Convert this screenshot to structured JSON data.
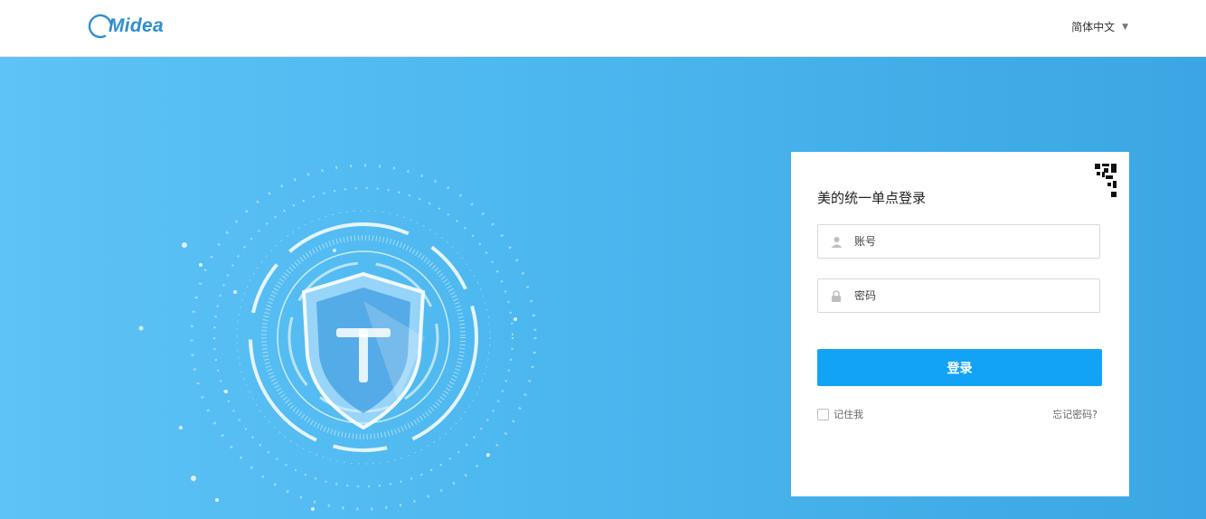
{
  "header": {
    "logo_text": "Midea",
    "language": "简体中文"
  },
  "login": {
    "title": "美的统一单点登录",
    "username_placeholder": "账号",
    "password_placeholder": "密码",
    "submit_label": "登录",
    "remember_label": "记住我",
    "forgot_label": "忘记密码?"
  },
  "icons": {
    "logo": "midea-logo",
    "caret": "chevron-down-icon",
    "qr": "qr-code-icon",
    "user": "user-icon",
    "lock": "lock-icon",
    "hero": "shield-illustration"
  },
  "colors": {
    "brand": "#2f8ed0",
    "hero_start": "#5ec3f6",
    "hero_end": "#3aa6e3",
    "primary_button": "#12a3f6"
  }
}
